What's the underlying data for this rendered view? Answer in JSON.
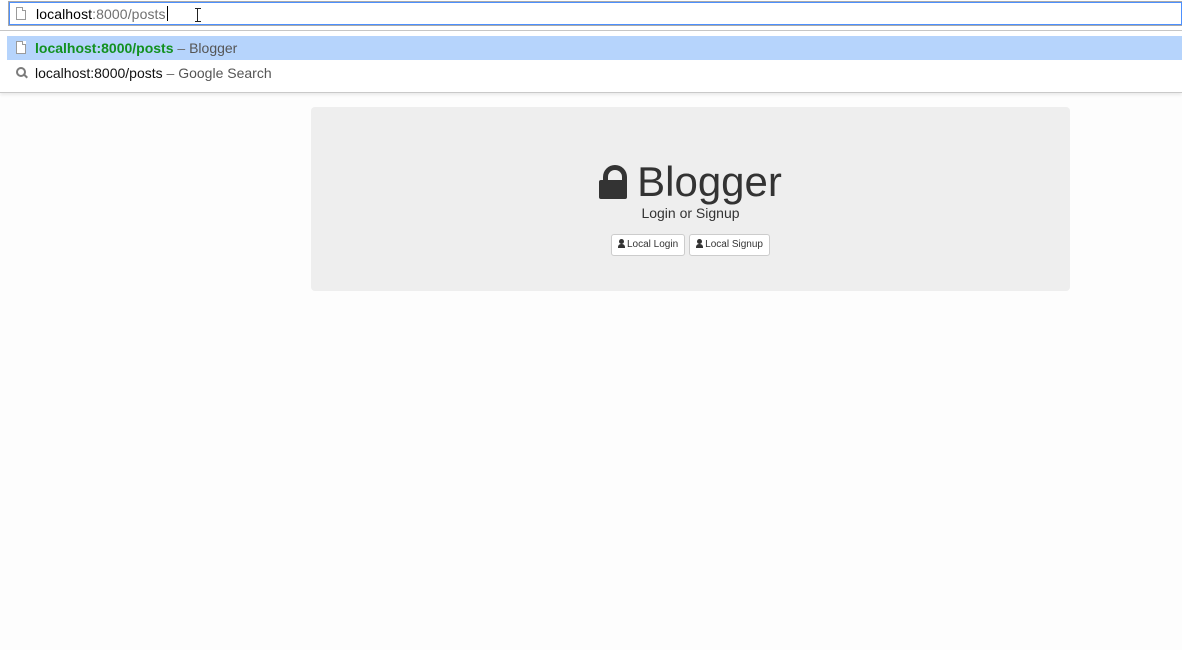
{
  "omnibox": {
    "url_host": "localhost",
    "url_rest": ":8000/posts"
  },
  "suggestions": [
    {
      "url": "localhost:8000/posts",
      "separator": " – ",
      "title": "Blogger",
      "icon": "page-icon",
      "selected": true
    },
    {
      "url": "localhost:8000/posts",
      "separator": " – ",
      "title": "Google Search",
      "icon": "search-icon",
      "selected": false
    }
  ],
  "page": {
    "brand": "Blogger",
    "brand_icon": "lock-icon",
    "subtitle": "Login or Signup",
    "login_button": "Local Login",
    "signup_button": "Local Signup",
    "button_icon": "user-icon"
  },
  "colors": {
    "selected_row": "#b6d4fc",
    "url_match_green": "#129120",
    "jumbotron_bg": "#eeeeee"
  }
}
